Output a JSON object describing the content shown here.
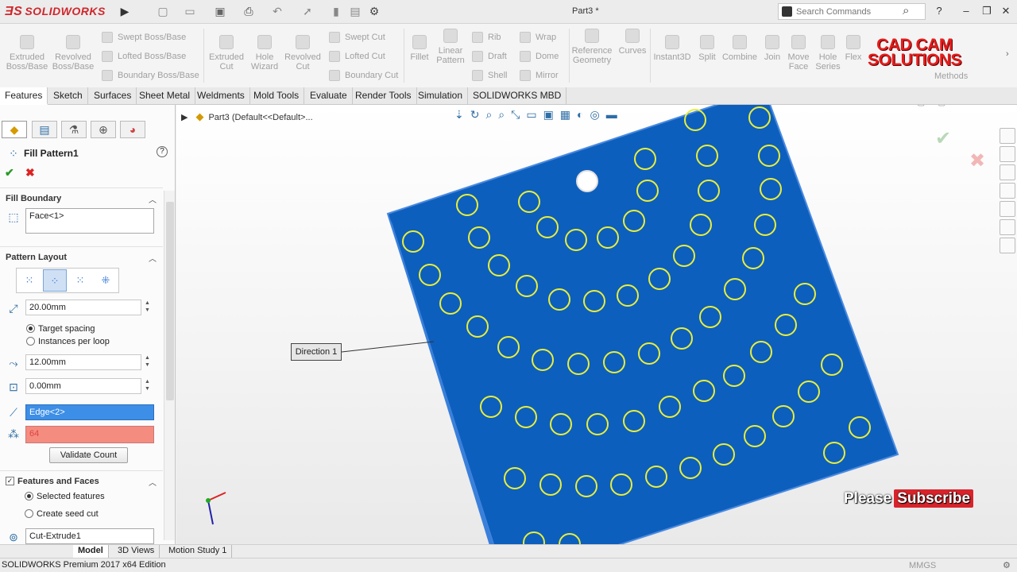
{
  "app": {
    "logo": "SOLIDWORKS",
    "document_title": "Part3 *"
  },
  "search": {
    "placeholder": "Search Commands"
  },
  "ribbon": {
    "large_buttons": [
      {
        "label": "Extruded\nBoss/Base",
        "icon": "extrude-boss-icon"
      },
      {
        "label": "Revolved\nBoss/Base",
        "icon": "revolve-boss-icon"
      },
      {
        "label": "Extruded\nCut",
        "icon": "extrude-cut-icon"
      },
      {
        "label": "Hole\nWizard",
        "icon": "hole-wizard-icon"
      },
      {
        "label": "Revolved\nCut",
        "icon": "revolve-cut-icon"
      },
      {
        "label": "Fillet",
        "icon": "fillet-icon"
      },
      {
        "label": "Linear\nPattern",
        "icon": "linear-pattern-icon"
      },
      {
        "label": "Reference\nGeometry",
        "icon": "reference-geometry-icon"
      },
      {
        "label": "Curves",
        "icon": "curves-icon"
      },
      {
        "label": "Instant3D",
        "icon": "instant3d-icon"
      },
      {
        "label": "Split",
        "icon": "split-icon"
      },
      {
        "label": "Combine",
        "icon": "combine-icon"
      },
      {
        "label": "Join",
        "icon": "join-icon"
      },
      {
        "label": "Move\nFace",
        "icon": "move-face-icon"
      },
      {
        "label": "Hole\nSeries",
        "icon": "hole-series-icon"
      },
      {
        "label": "Flex",
        "icon": "flex-icon"
      }
    ],
    "small_buttons": [
      {
        "label": "Swept Boss/Base"
      },
      {
        "label": "Lofted Boss/Base"
      },
      {
        "label": "Boundary Boss/Base"
      },
      {
        "label": "Swept Cut"
      },
      {
        "label": "Lofted Cut"
      },
      {
        "label": "Boundary Cut"
      },
      {
        "label": "Rib"
      },
      {
        "label": "Draft"
      },
      {
        "label": "Shell"
      },
      {
        "label": "Wrap"
      },
      {
        "label": "Dome"
      },
      {
        "label": "Mirror"
      }
    ],
    "partial_label": "Methods"
  },
  "brand_overlay": "CAD CAM\nSOLUTIONS",
  "tabs": [
    "Features",
    "Sketch",
    "Surfaces",
    "Sheet Metal",
    "Weldments",
    "Mold Tools",
    "Evaluate",
    "Render Tools",
    "Simulation",
    "SOLIDWORKS MBD"
  ],
  "property_manager": {
    "title": "Fill Pattern1",
    "fill_boundary": {
      "heading": "Fill Boundary",
      "value": "Face<1>"
    },
    "pattern_layout": {
      "heading": "Pattern Layout",
      "spacing": "20.00mm",
      "radio_target": "Target spacing",
      "radio_instances": "Instances per loop",
      "loop_spacing": "12.00mm",
      "margin": "0.00mm",
      "direction_edge": "Edge<2>",
      "instance_count": "64",
      "validate_label": "Validate Count"
    },
    "features_and_faces": {
      "heading": "Features and Faces",
      "radio_selected": "Selected features",
      "radio_seed": "Create seed cut",
      "list_value": "Cut-Extrude1"
    }
  },
  "viewport": {
    "breadcrumb": "Part3  (Default<<Default>...",
    "direction_label": "Direction 1",
    "plate_color": "#0d5fbd",
    "hole_color": "#e8ee3c",
    "promo_please": "Please",
    "promo_subscribe": "Subscribe"
  },
  "bottom_tabs": [
    "Model",
    "3D Views",
    "Motion Study 1"
  ],
  "status": {
    "text": "SOLIDWORKS Premium 2017 x64 Edition",
    "units": "MMGS"
  }
}
